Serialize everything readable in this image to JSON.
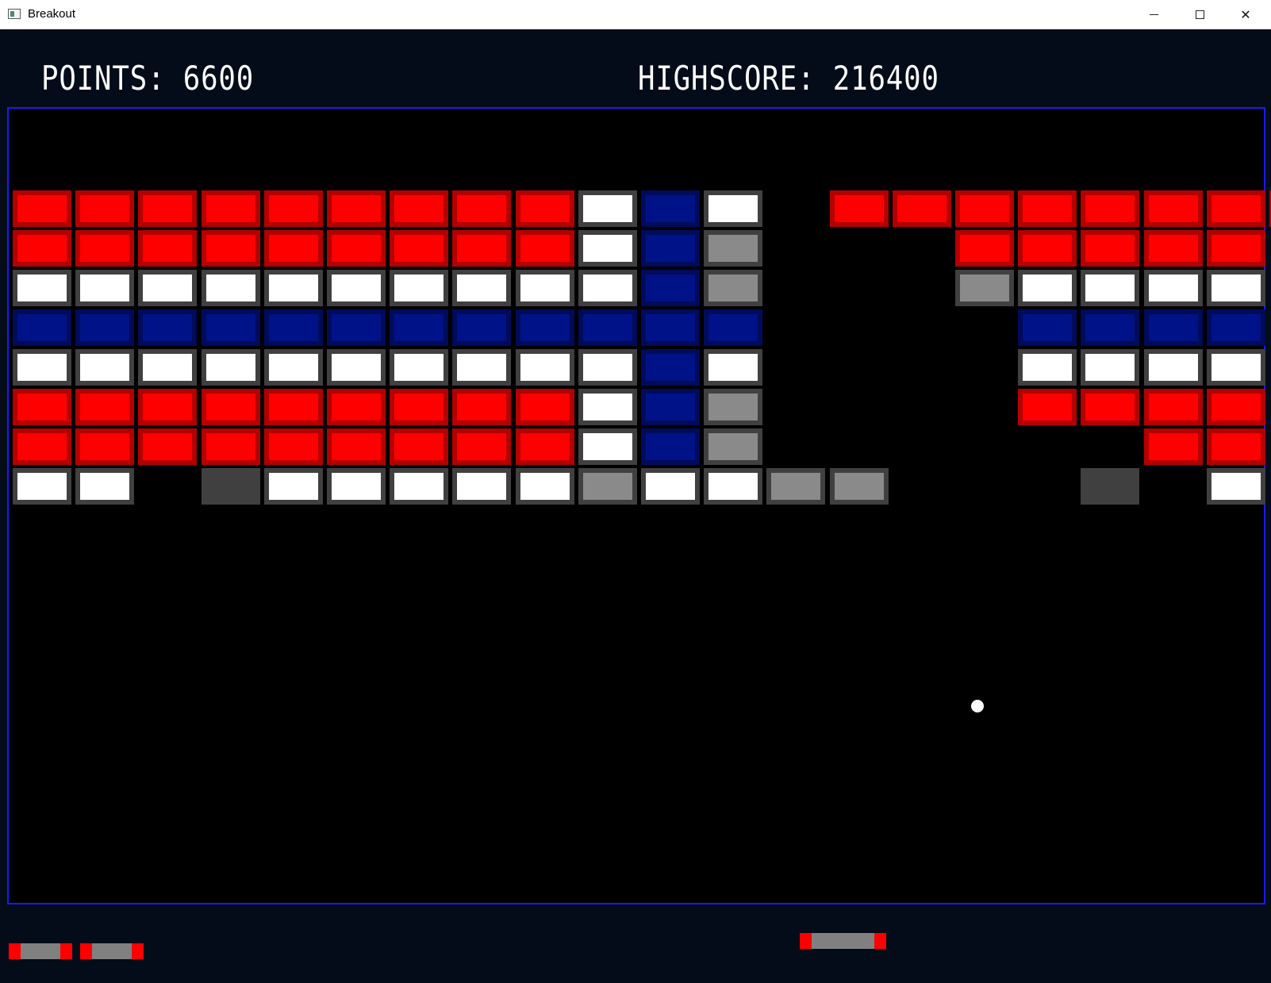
{
  "window": {
    "title": "Breakout",
    "controls": [
      "minimize-icon",
      "maximize-icon",
      "close-icon"
    ]
  },
  "hud": {
    "points_text": "POINTS: 6600",
    "highscore_text": "HIGHSCORE: 216400"
  },
  "game": {
    "lives_remaining": 2,
    "brick_legend": {
      "R": "red",
      "W": "white",
      "G": "gray",
      "B": "blue",
      "D": "dark",
      ".": "empty"
    },
    "brick_rows": [
      "RRRRRRRRRWBW.RRRRRRRR",
      "RRRRRRRRRWBG...RRRRR",
      "WWWWWWWWWWBG...GWWWW",
      "BBBBBBBBBBBB....BBBB",
      "WWWWWWWWWWBW....WWWW",
      "RRRRRRRRRWBG....RRRR",
      "RRRRRRRRRWBG......RR",
      "WW.DWWWWWGWWGG...D.W"
    ],
    "colors": {
      "background": "#000000",
      "frame": "#1a1aff",
      "red": "#ff0000",
      "blue": "#001287",
      "white": "#ffffff",
      "gray": "#8a8a8a",
      "dark": "#404040"
    }
  }
}
